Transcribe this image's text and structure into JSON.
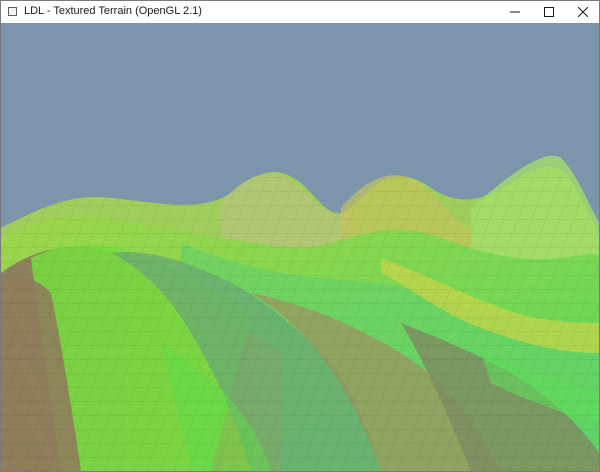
{
  "window": {
    "title": "LDL - Textured Terrain (OpenGL 2.1)",
    "controls": [
      "minimize-icon",
      "maximize-icon",
      "close-icon"
    ]
  },
  "viewport": {
    "sky_color": "#7d95ab",
    "terrain_colors": [
      "#5fe43a",
      "#8fd23e",
      "#9c8a5a",
      "#6fa06a",
      "#4fd06f",
      "#b0c94a"
    ]
  }
}
